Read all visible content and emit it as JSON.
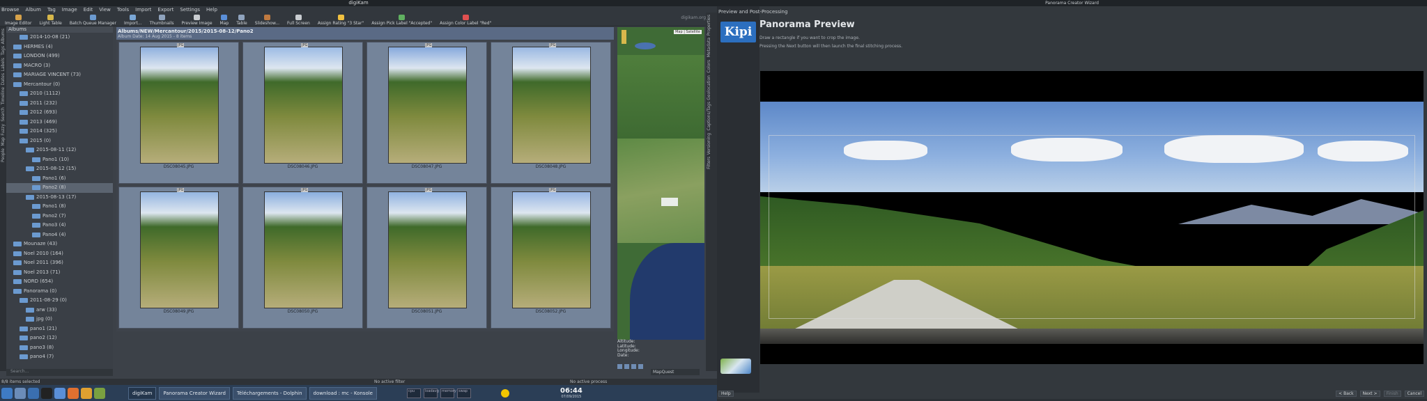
{
  "digikam": {
    "window_title": "digiKam",
    "menu": [
      "Browse",
      "Album",
      "Tag",
      "Image",
      "Edit",
      "View",
      "Tools",
      "Import",
      "Export",
      "Settings",
      "Help"
    ],
    "toolbar": [
      "Image Editor",
      "Light Table",
      "Batch Queue Manager",
      "Import...",
      "Thumbnails",
      "Preview Image",
      "Map",
      "Table",
      "Slideshow...",
      "Full Screen",
      "Assign Rating \"3 Star\"",
      "Assign Pick Label \"Accepted\"",
      "Assign Color Label \"Red\""
    ],
    "domain": "digikam.org",
    "left_tabs": [
      "Albums",
      "Tags",
      "Labels",
      "Dates",
      "Timeline",
      "Search",
      "Fuzzy",
      "Map",
      "People"
    ],
    "albums_header": "Albums",
    "tree": [
      {
        "label": "2014-10-08 (21)",
        "indent": 3
      },
      {
        "label": "HERMES (4)",
        "indent": 2
      },
      {
        "label": "LONDON (499)",
        "indent": 2
      },
      {
        "label": "MACRO (3)",
        "indent": 2
      },
      {
        "label": "MARIAGE VINCENT (73)",
        "indent": 2
      },
      {
        "label": "Mercantour (0)",
        "indent": 2
      },
      {
        "label": "2010 (1112)",
        "indent": 3
      },
      {
        "label": "2011 (232)",
        "indent": 3
      },
      {
        "label": "2012 (693)",
        "indent": 3
      },
      {
        "label": "2013 (469)",
        "indent": 3
      },
      {
        "label": "2014 (325)",
        "indent": 3
      },
      {
        "label": "2015 (0)",
        "indent": 3
      },
      {
        "label": "2015-08-11 (12)",
        "indent": 4
      },
      {
        "label": "Pano1 (10)",
        "indent": 5
      },
      {
        "label": "2015-08-12 (15)",
        "indent": 4
      },
      {
        "label": "Pano1 (6)",
        "indent": 5
      },
      {
        "label": "Pano2 (8)",
        "indent": 5,
        "selected": true
      },
      {
        "label": "2015-08-13 (17)",
        "indent": 4
      },
      {
        "label": "Pano1 (8)",
        "indent": 5
      },
      {
        "label": "Pano2 (7)",
        "indent": 5
      },
      {
        "label": "Pano3 (4)",
        "indent": 5
      },
      {
        "label": "Pano4 (4)",
        "indent": 5
      },
      {
        "label": "Mounaze (43)",
        "indent": 2
      },
      {
        "label": "Noel 2010 (164)",
        "indent": 2
      },
      {
        "label": "Noel 2011 (396)",
        "indent": 2
      },
      {
        "label": "Noel 2013 (71)",
        "indent": 2
      },
      {
        "label": "NORD (654)",
        "indent": 2
      },
      {
        "label": "Panorama (0)",
        "indent": 2
      },
      {
        "label": "2011-08-29 (0)",
        "indent": 3
      },
      {
        "label": "arw (33)",
        "indent": 4
      },
      {
        "label": "jpg (0)",
        "indent": 4
      },
      {
        "label": "pano1 (21)",
        "indent": 3
      },
      {
        "label": "pano2 (12)",
        "indent": 3
      },
      {
        "label": "pano3 (8)",
        "indent": 3
      },
      {
        "label": "pano4 (7)",
        "indent": 3
      }
    ],
    "search_placeholder": "Search...",
    "album_path": "Albums/NEW/Mercantour/2015/2015-08-12/Pano2",
    "album_info": "Album Date: 14 Aug 2015 - 8 items",
    "thumb_badge": "JPG",
    "thumbnails": [
      "DSC08045.JPG",
      "DSC08046.JPG",
      "DSC08047.JPG",
      "DSC08048.JPG",
      "DSC08049.JPG",
      "DSC08050.JPG",
      "DSC08051.JPG",
      "DSC08052.JPG"
    ],
    "map_button": "Map | Satellite",
    "map_info": [
      "Altitude:",
      "Latitude:",
      "Longitude:",
      "Date:"
    ],
    "map_provider": "MapQuest",
    "status_items": "8/8 items selected",
    "status_filter": "No active filter",
    "status_process": "No active process",
    "right_tabs": [
      "Properties",
      "Metadata",
      "Colors",
      "Geolocation",
      "Captions/Tags",
      "Versioning",
      "Filters"
    ]
  },
  "wizard": {
    "window_title": "Panorama Creator Wizard",
    "sidebar_header": "Preview and Post-Processing",
    "kipi": "Kipi",
    "heading": "Panorama Preview",
    "desc1": "Draw a rectangle if you want to crop the image.",
    "desc2": "Pressing the Next button will then launch the final stitching process.",
    "help": "Help",
    "buttons": [
      "< Back",
      "Next >",
      "Finish",
      "Cancel"
    ]
  },
  "taskbar": {
    "tasks": [
      "digiKam",
      "Panorama Creator Wizard",
      "Téléchargements - Dolphin",
      "download : mc - Konsole"
    ],
    "monitors": [
      "cpu",
      "loadavg",
      "memory",
      "swap"
    ],
    "clock": "06:44",
    "date": "07/09/2015"
  },
  "colors": {
    "accent": "#2c6fbf",
    "selection": "#5b6470",
    "thumb_bg": "#74849a"
  }
}
